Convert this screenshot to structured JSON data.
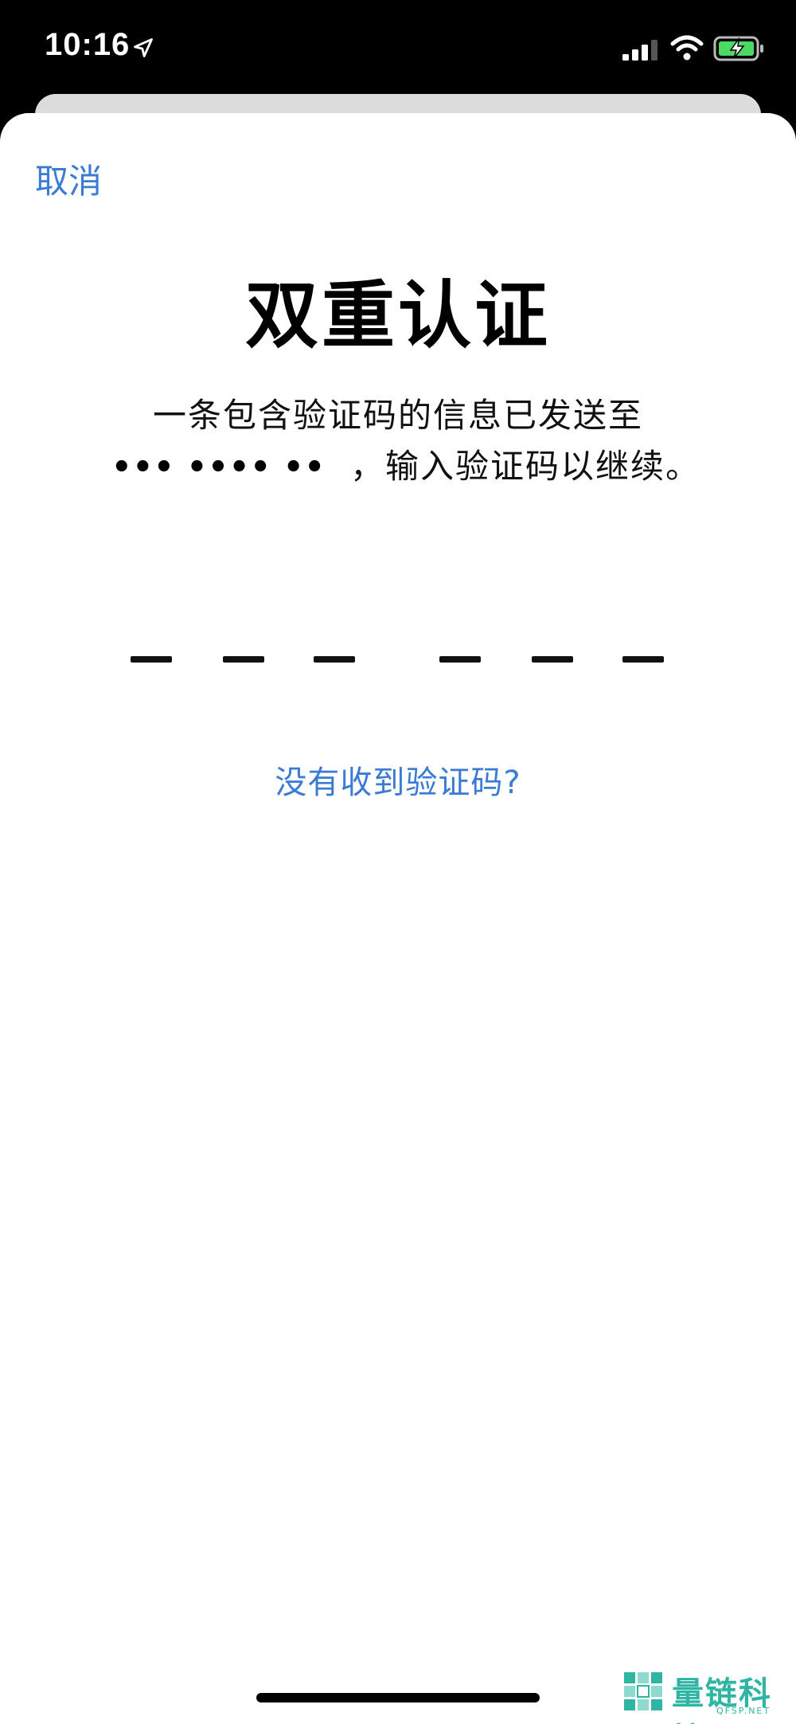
{
  "status_bar": {
    "time": "10:16",
    "icons": [
      "location-arrow-icon",
      "cellular-signal-icon",
      "wifi-icon",
      "battery-charging-icon"
    ],
    "battery_color": "#4cd964"
  },
  "nav": {
    "cancel_label": "取消"
  },
  "main": {
    "title": "双重认证",
    "description_line1": "一条包含验证码的信息已发送至",
    "masked_number": "••• •••• ••",
    "description_line2_suffix": "，输入验证码以继续。",
    "code_slots": 6,
    "resend_label": "没有收到验证码?"
  },
  "watermark": {
    "text": "量链科技",
    "sub": "QFSP.NET"
  },
  "colors": {
    "accent": "#3a7bd5",
    "watermark": "#2fb5a3"
  }
}
